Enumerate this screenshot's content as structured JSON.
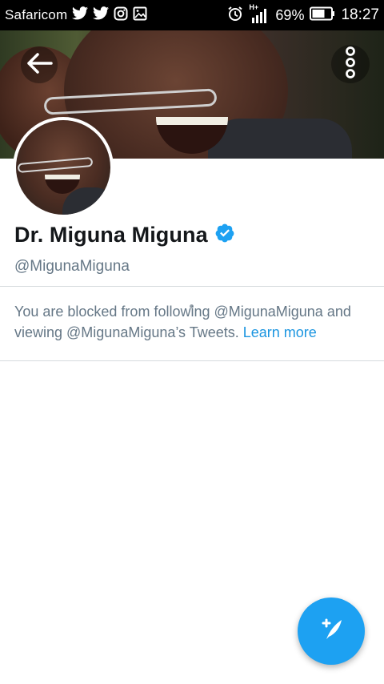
{
  "status_bar": {
    "carrier": "Safaricom",
    "network_type": "H+",
    "battery_percent": "69%",
    "time": "18:27",
    "left_icons": [
      "twitter-icon",
      "twitter-icon",
      "instagram-icon",
      "gallery-icon"
    ],
    "right_icons": [
      "alarm-icon",
      "signal-icon",
      "battery-icon"
    ]
  },
  "header": {
    "back_icon": "arrow-left-icon",
    "more_icon": "more-vertical-icon"
  },
  "profile": {
    "display_name": "Dr. Miguna Miguna",
    "verified": true,
    "verified_icon": "verified-badge-icon",
    "handle": "@MigunaMiguna"
  },
  "blocked_notice": {
    "text": "You are blocked from following @MigunaMiguna and viewing @MigunaMiguna’s Tweets.",
    "link_text": "Learn more"
  },
  "fab": {
    "icon": "compose-tweet-icon"
  },
  "colors": {
    "accent": "#1da1f2",
    "link": "#1b95e0",
    "secondary_text": "#657786",
    "primary_text": "#14171a",
    "verified": "#1da1f2"
  }
}
